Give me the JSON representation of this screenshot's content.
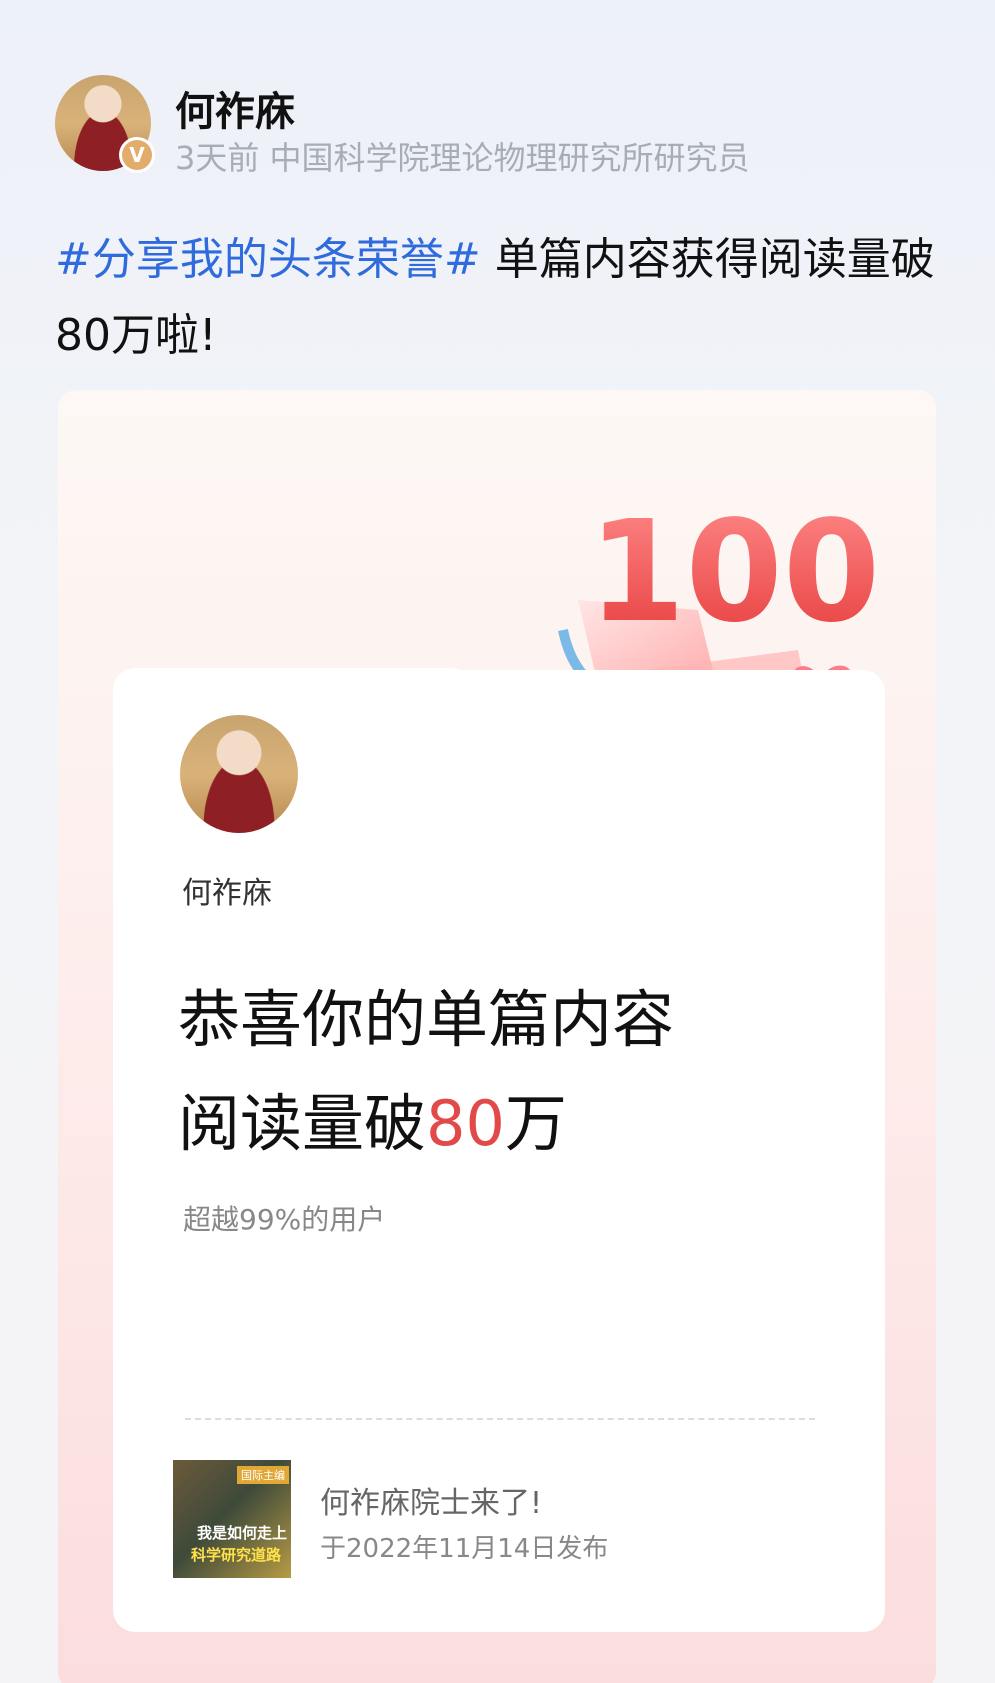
{
  "author": {
    "name": "何祚庥",
    "verified_mark": "V",
    "meta": "3天前 中国科学院理论物理研究所研究员"
  },
  "post": {
    "hashtag": "#分享我的头条荣誉#",
    "text": " 单篇内容获得阅读量破80万啦!"
  },
  "card": {
    "badge_number": "100",
    "name": "何祚庥",
    "congrats_line1": "恭喜你的单篇内容",
    "congrats_line2_prefix": "阅读量破",
    "congrats_number": "80",
    "congrats_line2_suffix": "万",
    "exceed_text": "超越99%的用户",
    "article": {
      "thumbnail_tag": "国际主编",
      "thumbnail_line1": "我是如何走上",
      "thumbnail_line2": "科学研究道路",
      "title": "何祚庥院士来了!",
      "date": "于2022年11月14日发布"
    }
  },
  "colors": {
    "hashtag": "#2f6bdc",
    "highlight_number": "#e24a4a",
    "verified_badge": "#e2ad6b"
  }
}
